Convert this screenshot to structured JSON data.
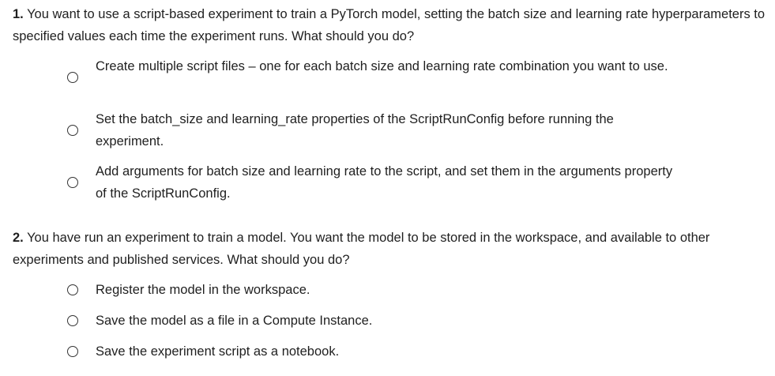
{
  "questions": [
    {
      "number": "1.",
      "text": "You want to use a script-based experiment to train a PyTorch model, setting the batch size and learning rate hyperparameters to specified values each time the experiment runs. What should you do?",
      "options": [
        "Create multiple script files – one for each batch size and learning rate combination you want to use.",
        "Set the batch_size and learning_rate properties of the ScriptRunConfig before running the experiment.",
        "Add arguments for batch size and learning rate to the script, and set them in the arguments property of the ScriptRunConfig."
      ]
    },
    {
      "number": "2.",
      "text": "You have run an experiment to train a model. You want the model to be stored in the workspace, and available to other experiments and published services. What should you do?",
      "options": [
        "Register the model in the workspace.",
        "Save the model as a file in a Compute Instance.",
        "Save the experiment script as a notebook."
      ]
    }
  ]
}
